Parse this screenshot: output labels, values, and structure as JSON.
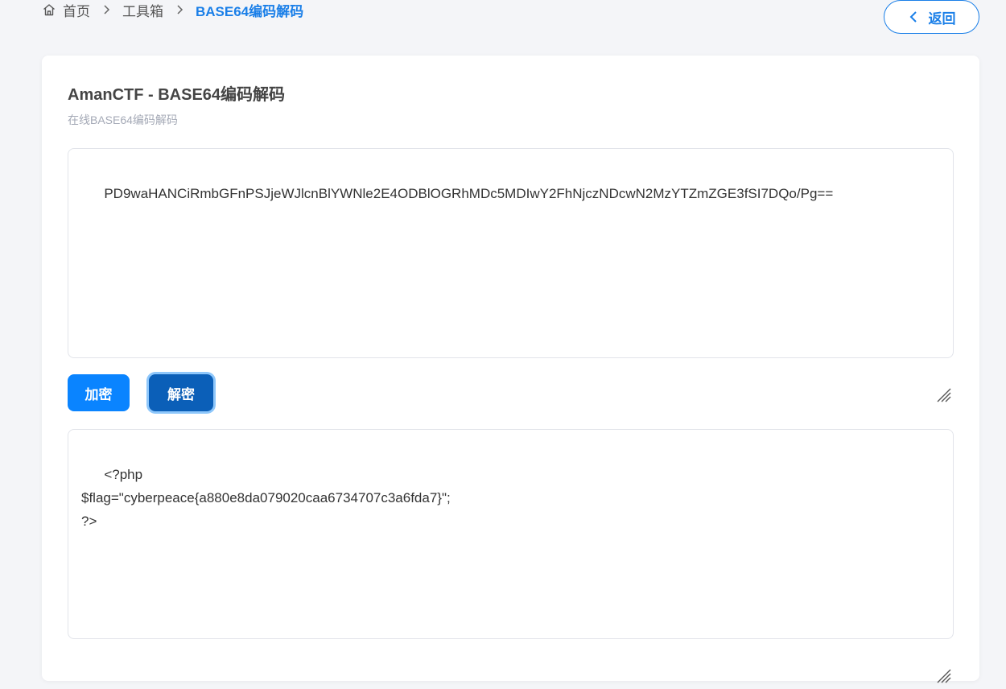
{
  "breadcrumb": {
    "items": [
      "首页",
      "工具箱",
      "BASE64编码解码"
    ]
  },
  "back_button": {
    "label": "返回"
  },
  "card": {
    "title": "AmanCTF - BASE64编码解码",
    "subtitle": "在线BASE64编码解码"
  },
  "input": {
    "value": "PD9waHANCiRmbGFnPSJjeWJlcnBlYWNle2E4ODBlOGRhMDc5MDIwY2FhNjczNDcwN2MzYTZmZGE3fSI7DQo/Pg=="
  },
  "buttons": {
    "encode_label": "加密",
    "decode_label": "解密"
  },
  "output": {
    "value": "<?php\n$flag=\"cyberpeace{a880e8da079020caa6734707c3a6fda7}\";\n?>"
  },
  "icons": {
    "home": "home-icon",
    "separator": "chevron-right-icon",
    "back": "chevron-left-icon",
    "resize": "resize-handle-icon"
  },
  "colors": {
    "accent": "#1a7fe8",
    "encode_button": "#0a84ff",
    "decode_button": "#0b5fb8",
    "background": "#f4f5f8"
  }
}
